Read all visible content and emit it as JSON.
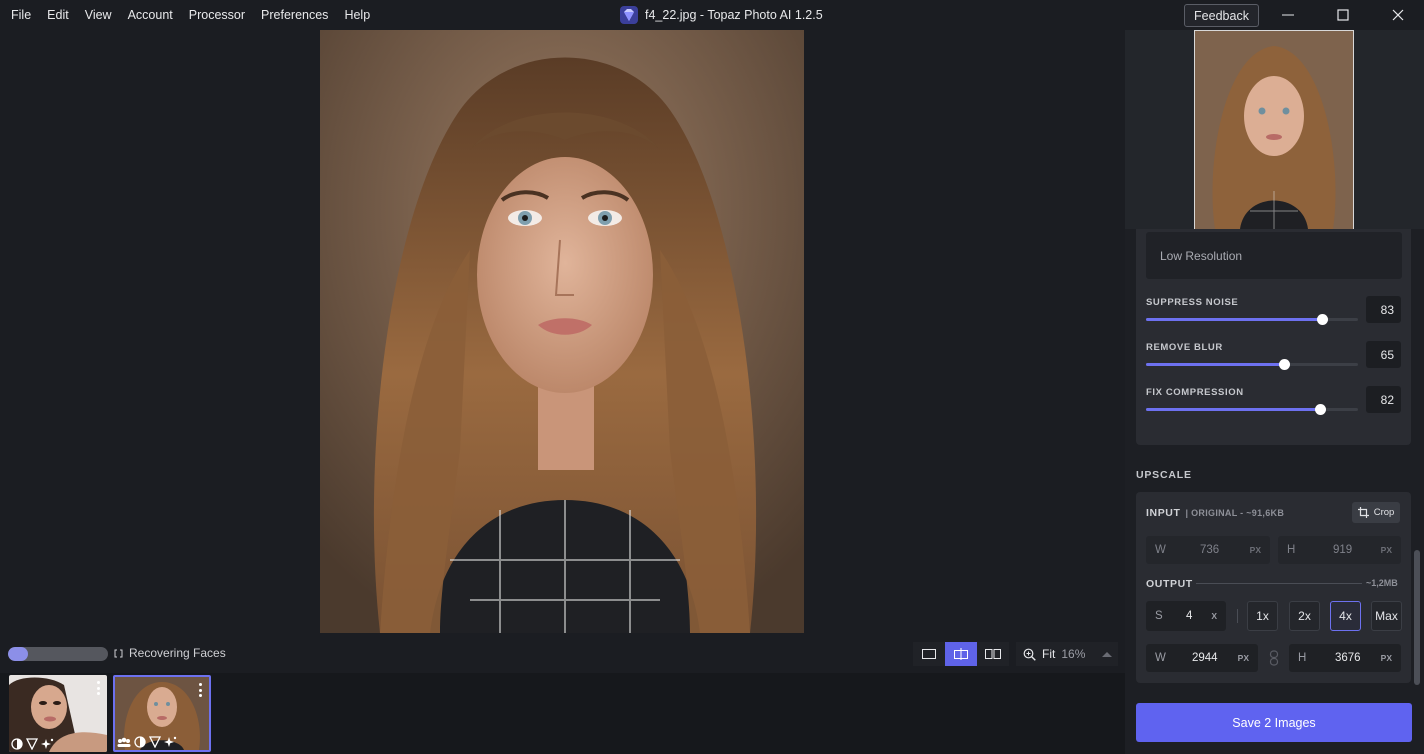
{
  "menu": [
    "File",
    "Edit",
    "View",
    "Account",
    "Processor",
    "Preferences",
    "Help"
  ],
  "window": {
    "title": "f4_22.jpg - Topaz Photo AI 1.2.5",
    "feedback": "Feedback"
  },
  "status": {
    "task": "Recovering Faces",
    "progress": 0.2,
    "zoom_label": "Fit",
    "zoom_value": "16%"
  },
  "enhance": {
    "model": "Low Resolution",
    "sliders": [
      {
        "label": "SUPPRESS NOISE",
        "value": "83",
        "level": 0.83
      },
      {
        "label": "REMOVE BLUR",
        "value": "65",
        "level": 0.65
      },
      {
        "label": "FIX COMPRESSION",
        "value": "82",
        "level": 0.82
      }
    ]
  },
  "upscale": {
    "title": "UPSCALE",
    "input_label": "INPUT",
    "input_sub": "| ORIGINAL - ~91,6KB",
    "crop_label": "Crop",
    "input_w_key": "W",
    "input_w": "736",
    "input_w_unit": "PX",
    "input_h_key": "H",
    "input_h": "919",
    "input_h_unit": "PX",
    "output_label": "OUTPUT",
    "output_size": "~1,2MB",
    "scale_key": "S",
    "scale_value": "4",
    "scale_unit": "X",
    "presets": [
      "1x",
      "2x",
      "4x",
      "Max"
    ],
    "active_preset": "4x",
    "output_w_key": "W",
    "output_w": "2944",
    "output_w_unit": "PX",
    "output_h_key": "H",
    "output_h": "3676",
    "output_h_unit": "PX"
  },
  "save_label": "Save 2 Images",
  "colors": {
    "accent": "#5f63f0",
    "panel": "#2a2c32",
    "background": "#1b1d22"
  }
}
